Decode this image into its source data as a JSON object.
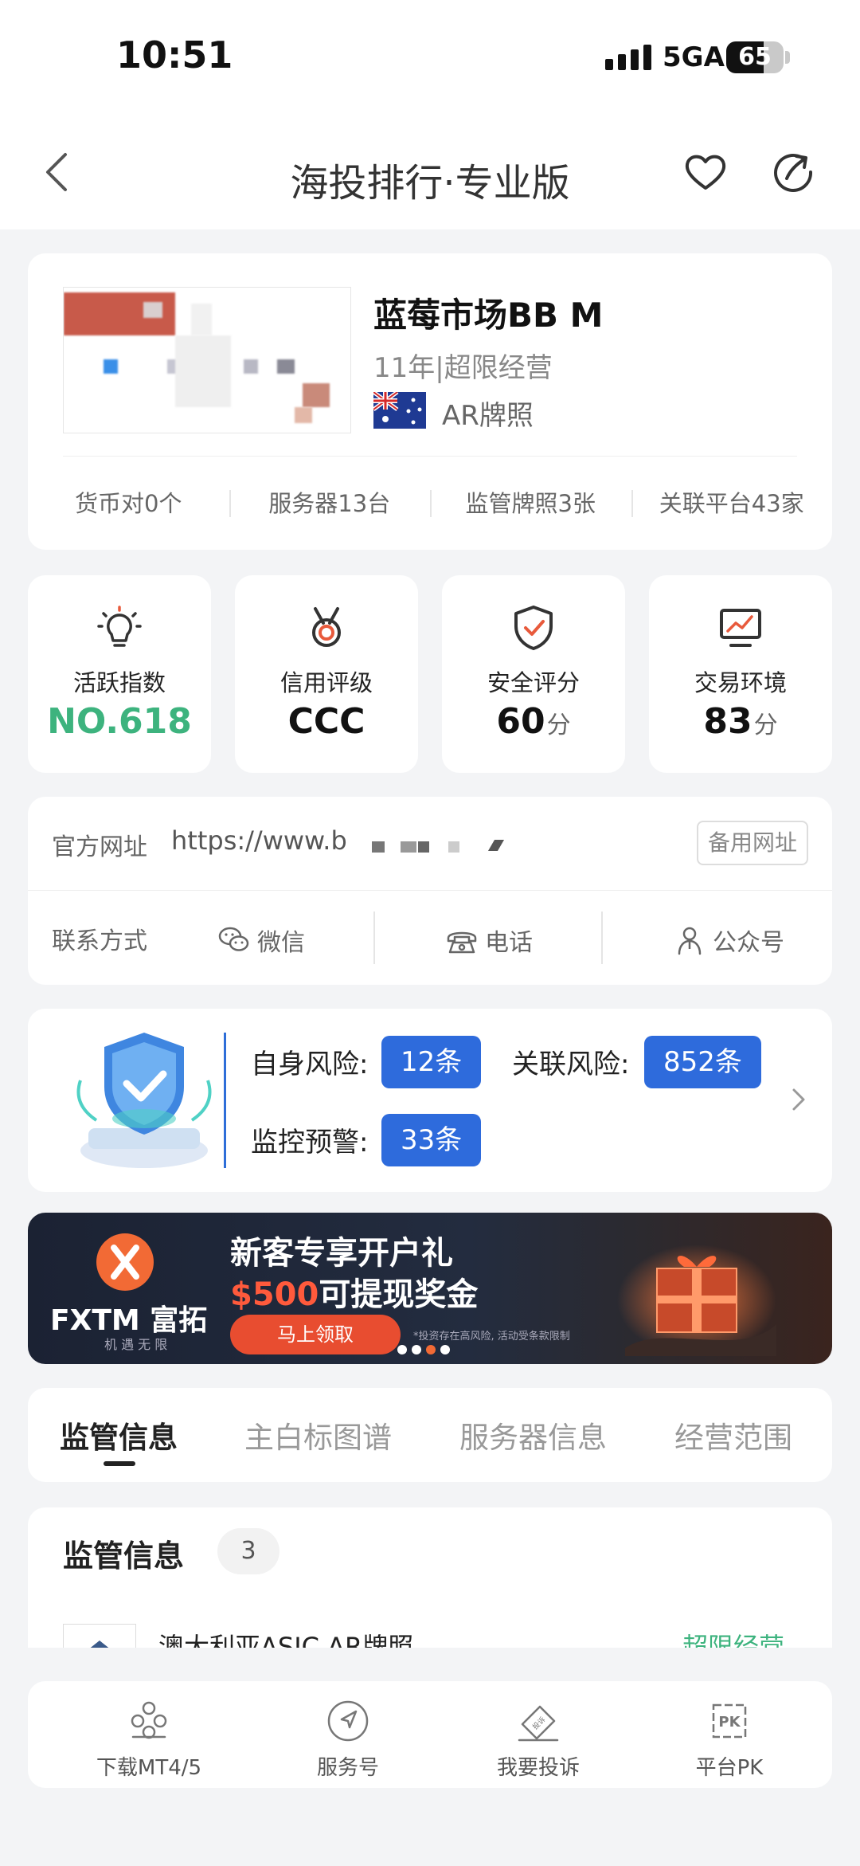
{
  "status_bar": {
    "time": "10:51",
    "network": "5GA",
    "battery": "65"
  },
  "navbar": {
    "title": "海投排行·专业版"
  },
  "broker": {
    "name": "蓝莓市场BB M",
    "meta": "11年|超限经营",
    "license": "AR牌照",
    "stats": [
      "货币对0个",
      "服务器13台",
      "监管牌照3张",
      "关联平台43家"
    ]
  },
  "metrics": [
    {
      "label": "活跃指数",
      "value": "NO.618",
      "unit": ""
    },
    {
      "label": "信用评级",
      "value": "CCC",
      "unit": ""
    },
    {
      "label": "安全评分",
      "value": "60",
      "unit": "分"
    },
    {
      "label": "交易环境",
      "value": "83",
      "unit": "分"
    }
  ],
  "links": {
    "website_label": "官方网址",
    "website_url": "https://www.b",
    "backup_label": "备用网址",
    "contact_label": "联系方式",
    "wechat": "微信",
    "phone": "电话",
    "official_account": "公众号"
  },
  "risk": {
    "self_label": "自身风险:",
    "self_value": "12条",
    "related_label": "关联风险:",
    "related_value": "852条",
    "monitor_label": "监控预警:",
    "monitor_value": "33条"
  },
  "banner": {
    "brand": "FXTM 富拓",
    "tagline": "机 遇 无 限",
    "title": "新客专享开户礼",
    "amount": "$500",
    "subtitle_rest": "可提现奖金",
    "cta": "马上领取",
    "note": "*投资存在高风险, 活动受条款限制"
  },
  "tabs": [
    "监管信息",
    "主白标图谱",
    "服务器信息",
    "经营范围"
  ],
  "regulation": {
    "title": "监管信息",
    "count": "3",
    "row_name": "澳大利亚ASIC  AR牌照",
    "row_status": "超限经营"
  },
  "bottom_nav": [
    "下载MT4/5",
    "服务号",
    "我要投诉",
    "平台PK"
  ],
  "colors": {
    "accent_blue": "#2e6bdc",
    "green": "#3db37e",
    "orange": "#f26a35"
  }
}
